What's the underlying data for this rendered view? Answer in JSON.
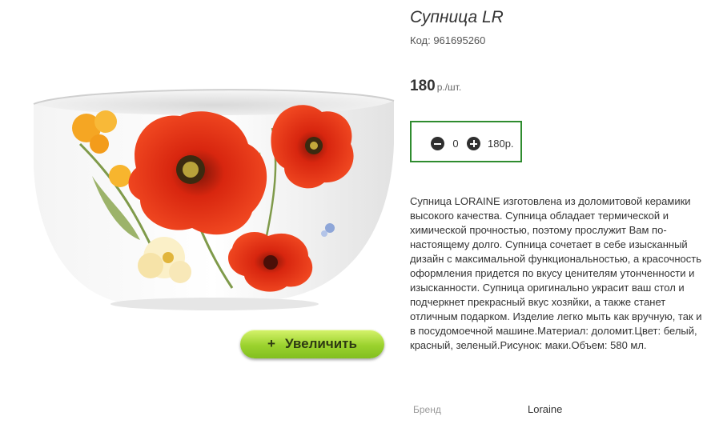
{
  "product": {
    "title": "Супница LR",
    "code": "Код: 961695260",
    "price_value": "180",
    "price_unit": "р./шт.",
    "image_alt": "Супница LR"
  },
  "quantity": {
    "value": "0",
    "total": "180р."
  },
  "zoom_button": {
    "icon": "+",
    "label": "Увеличить"
  },
  "description": "Супница LORAINE изготовлена из доломитовой керамики высокого качества. Супница обладает термической и химической прочностью, поэтому прослужит Вам по-настоящему долго. Супница сочетает в себе изысканный дизайн с максимальной функциональностью, а красочность оформления придется по вкусу ценителям утонченности и изысканности. Супница оригинально украсит ваш стол и подчеркнет прекрасный вкус хозяйки, а также станет отличным подарком. Изделие легко мыть как вручную, так и в посудомоечной машине.Материал: доломит.Цвет: белый, красный, зеленый.Рисунок: маки.Объем: 580 мл.",
  "attributes": {
    "brand_label": "Бренд",
    "brand_value": "Loraine"
  },
  "colors": {
    "accent_green": "#2f8c2f",
    "zoom_button_green": "#9bd22e",
    "poppy_red": "#e8341c"
  }
}
